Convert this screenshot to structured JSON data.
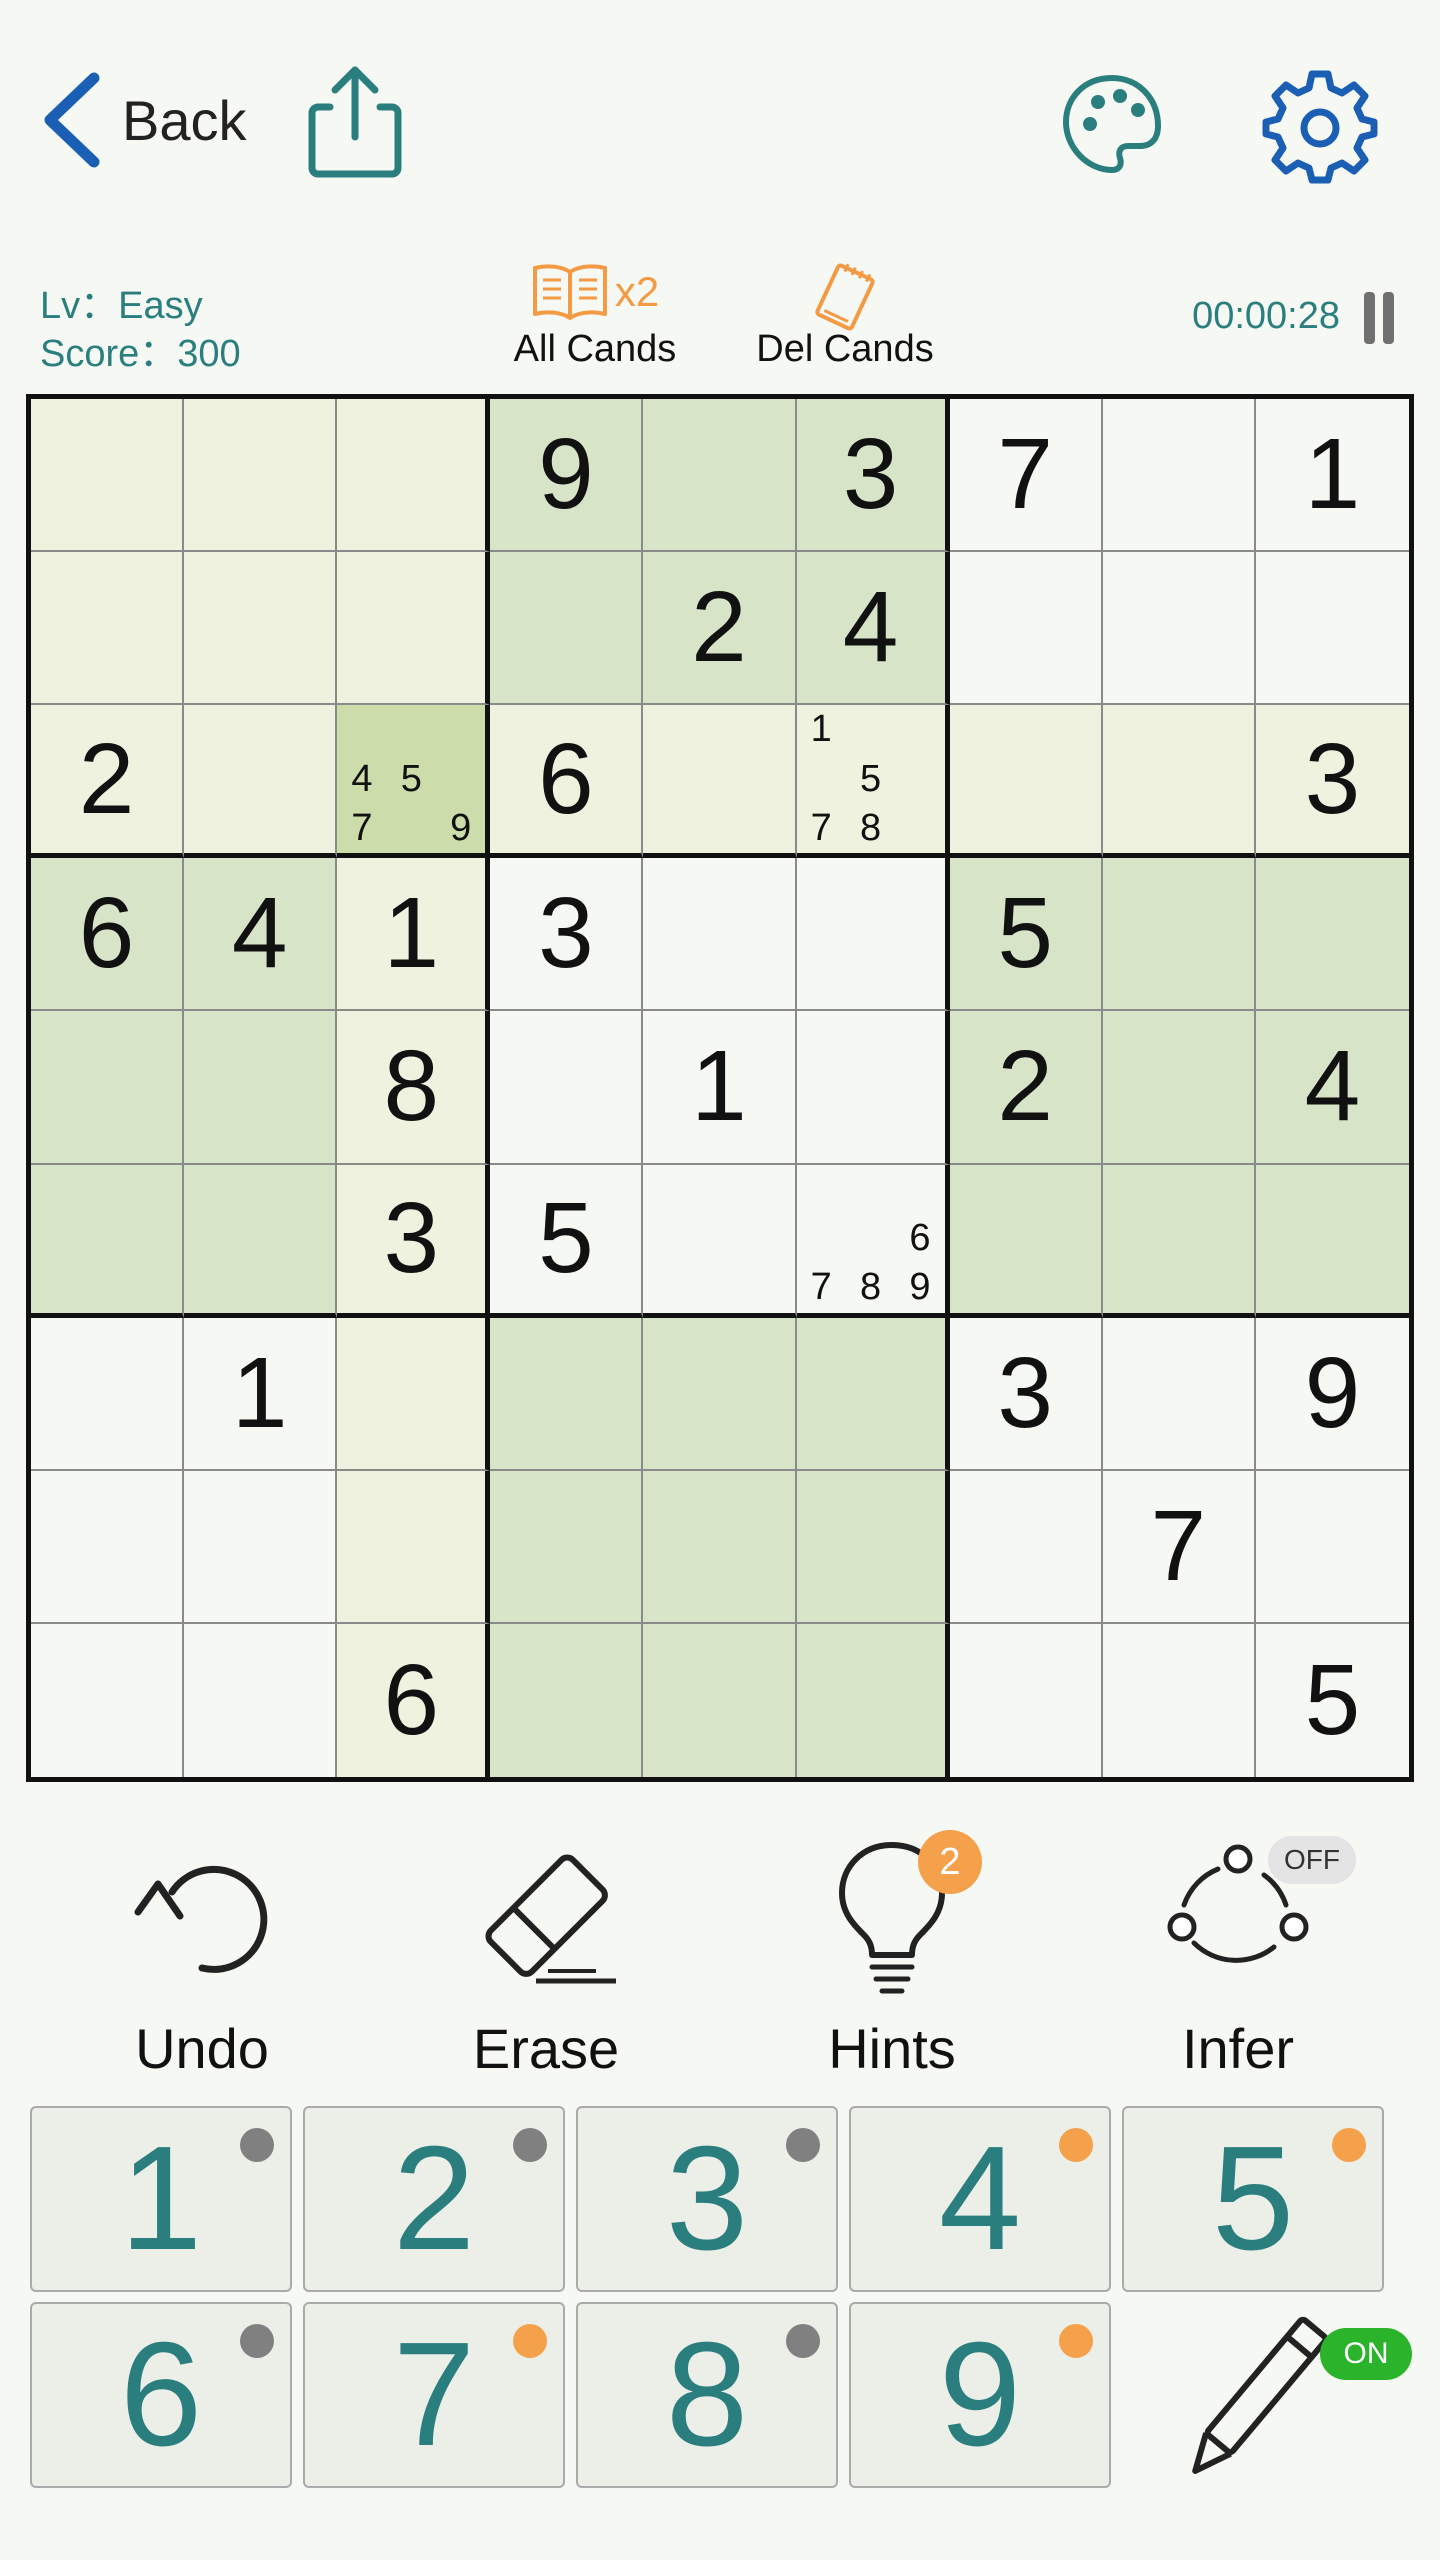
{
  "header": {
    "back_label": "Back",
    "icons": [
      "back-chevron-icon",
      "share-icon",
      "palette-icon",
      "gear-icon"
    ],
    "accent_color": "#2a7e7e",
    "nav_color": "#1a5fb4"
  },
  "info": {
    "level": "Lv：Easy",
    "score": "Score：300",
    "all_cands_label": "All Cands",
    "all_cands_count": "x2",
    "del_cands_label": "Del Cands",
    "timer": "00:00:28"
  },
  "board": {
    "givens": [
      [
        0,
        0,
        0,
        9,
        0,
        3,
        7,
        0,
        1
      ],
      [
        0,
        0,
        0,
        0,
        2,
        4,
        0,
        0,
        0
      ],
      [
        2,
        0,
        0,
        6,
        0,
        0,
        0,
        0,
        3
      ],
      [
        6,
        4,
        1,
        3,
        0,
        0,
        5,
        0,
        0
      ],
      [
        0,
        0,
        8,
        0,
        1,
        0,
        2,
        0,
        4
      ],
      [
        0,
        0,
        3,
        5,
        0,
        0,
        0,
        0,
        0
      ],
      [
        0,
        1,
        0,
        0,
        0,
        0,
        3,
        0,
        9
      ],
      [
        0,
        0,
        0,
        0,
        0,
        0,
        0,
        7,
        0
      ],
      [
        0,
        0,
        6,
        0,
        0,
        0,
        0,
        0,
        5
      ]
    ],
    "candidates": [
      {
        "row": 2,
        "col": 2,
        "values": [
          4,
          5,
          7,
          9
        ]
      },
      {
        "row": 2,
        "col": 5,
        "values": [
          1,
          5,
          7,
          8
        ]
      },
      {
        "row": 5,
        "col": 5,
        "values": [
          6,
          7,
          8,
          9
        ]
      }
    ],
    "selected": {
      "row": 2,
      "col": 2
    },
    "colors": {
      "green": "#d8e4c8",
      "yellow": "#eff2df",
      "selected": "#ccdcaa"
    },
    "shading": [
      "yyyggg...",
      "yyyggg...",
      "yysyyyyyy",
      "ggy...ggg",
      "ggy...ggg",
      "ggy...ggg",
      "..yggg...",
      "..yggg...",
      "..yggg..."
    ]
  },
  "tools": {
    "undo_label": "Undo",
    "erase_label": "Erase",
    "hints_label": "Hints",
    "hints_badge": "2",
    "infer_label": "Infer",
    "infer_state": "OFF"
  },
  "numpad": {
    "keys": [
      {
        "label": "1",
        "dot": "gray"
      },
      {
        "label": "2",
        "dot": "gray"
      },
      {
        "label": "3",
        "dot": "gray"
      },
      {
        "label": "4",
        "dot": "orange"
      },
      {
        "label": "5",
        "dot": "orange"
      },
      {
        "label": "6",
        "dot": "gray"
      },
      {
        "label": "7",
        "dot": "orange"
      },
      {
        "label": "8",
        "dot": "gray"
      },
      {
        "label": "9",
        "dot": "orange"
      }
    ],
    "dot_colors": {
      "gray": "#808080",
      "orange": "#f5a04a"
    },
    "pencil_state": "ON"
  }
}
